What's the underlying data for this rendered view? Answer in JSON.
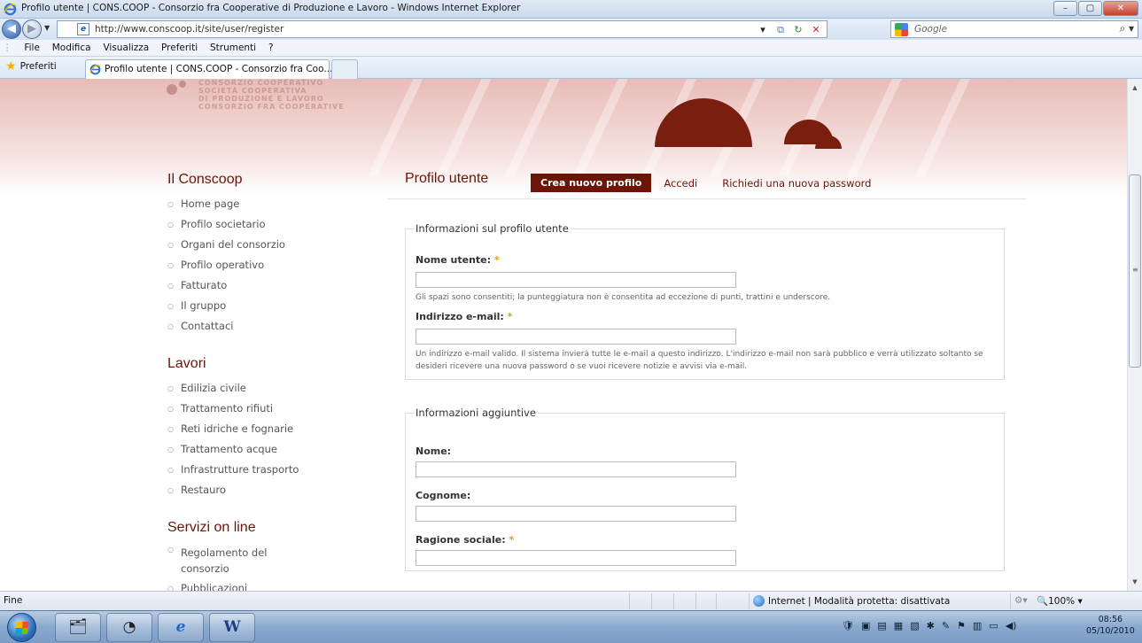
{
  "window": {
    "title": "Profilo utente | CONS.COOP - Consorzio fra Cooperative di Produzione e Lavoro - Windows Internet Explorer",
    "controls": [
      "–",
      "▢",
      "✕"
    ]
  },
  "addressbar": {
    "url": "http://www.conscoop.it/site/user/register",
    "search_placeholder": "Google"
  },
  "menubar": [
    "File",
    "Modifica",
    "Visualizza",
    "Preferiti",
    "Strumenti",
    "?"
  ],
  "favorites": {
    "label": "Preferiti"
  },
  "tab": {
    "label": "Profilo utente | CONS.COOP - Consorzio fra Coo..."
  },
  "header": {
    "logo_lines": [
      "CONSORZIO COOPERATIVO",
      "SOCIETÀ COOPERATIVA",
      "DI PRODUZIONE E LAVORO",
      "CONSORZIO FRA COOPERATIVE"
    ]
  },
  "sidebar": {
    "sections": [
      {
        "title": "Il Conscoop",
        "items": [
          "Home page",
          "Profilo societario",
          "Organi del consorzio",
          "Profilo operativo",
          "Fatturato",
          "Il gruppo",
          "Contattaci"
        ]
      },
      {
        "title": "Lavori",
        "items": [
          "Edilizia civile",
          "Trattamento rifiuti",
          "Reti idriche e fognarie",
          "Trattamento acque",
          "Infrastrutture trasporto",
          "Restauro"
        ]
      },
      {
        "title": "Servizi on line",
        "items": [
          "Regolamento del consorzio",
          "Pubblicazioni"
        ]
      }
    ]
  },
  "main": {
    "page_title": "Profilo utente",
    "tabs": {
      "active": "Crea nuovo profilo",
      "login": "Accedi",
      "password": "Richiedi una nuova password"
    },
    "fieldset1": {
      "legend": "Informazioni sul profilo utente",
      "username_label": "Nome utente:",
      "username_help": "Gli spazi sono consentiti; la punteggiatura non è consentita ad eccezione di punti, trattini e underscore.",
      "email_label": "Indirizzo e-mail:",
      "email_help": "Un indirizzo e-mail valido. Il sistema invierà tutte le e-mail a questo indirizzo. L'indirizzo e-mail non sarà pubblico e verrà utilizzato soltanto se desideri ricevere una nuova password o se vuoi ricevere notizie e avvisi via e-mail."
    },
    "fieldset2": {
      "legend": "Informazioni aggiuntive",
      "nome_label": "Nome:",
      "cognome_label": "Cognome:",
      "ragione_label": "Ragione sociale:"
    },
    "required_mark": "*"
  },
  "statusbar": {
    "status": "Fine",
    "zone": "Internet | Modalità protetta: disattivata",
    "zoom": "100%"
  },
  "taskbar": {
    "time": "08:56",
    "date": "05/10/2010"
  },
  "colors": {
    "brand": "#6b1508",
    "header_bg": "#e8bcb8",
    "required": "#e5a000"
  }
}
